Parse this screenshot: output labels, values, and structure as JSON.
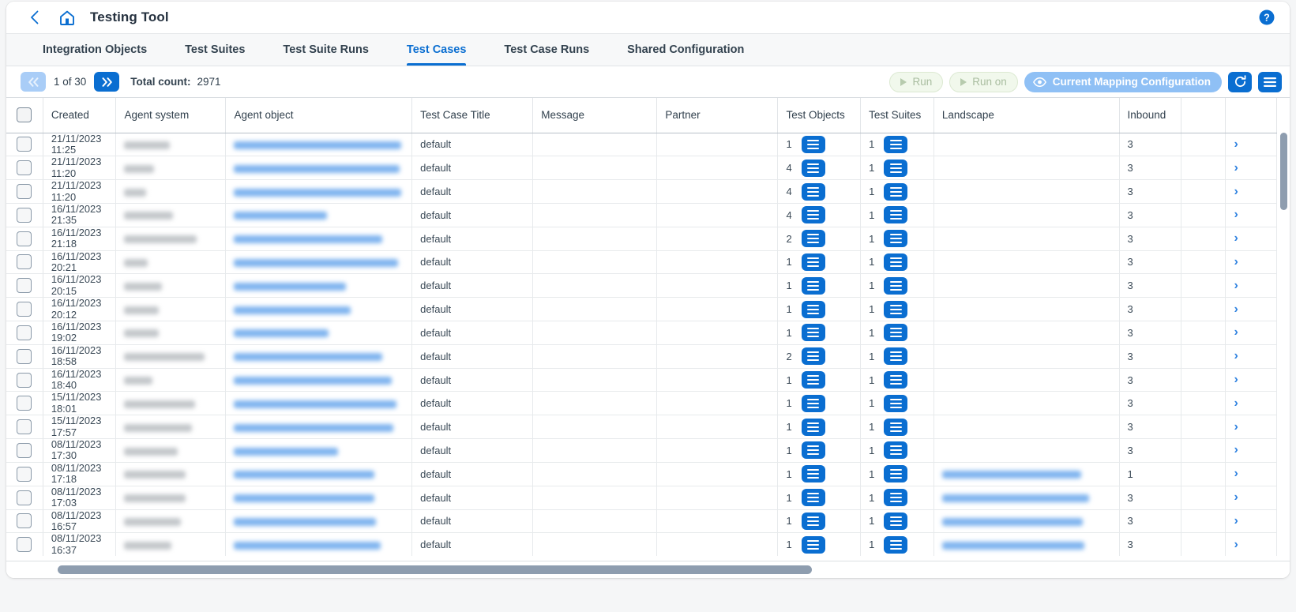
{
  "header": {
    "title": "Testing Tool",
    "back_icon": "chevron-left-icon",
    "home_icon": "home-icon",
    "help_icon": "help-circle-icon",
    "accent": "#0a6ed1"
  },
  "tabs": [
    {
      "label": "Integration Objects",
      "active": false
    },
    {
      "label": "Test Suites",
      "active": false
    },
    {
      "label": "Test Suite Runs",
      "active": false
    },
    {
      "label": "Test Cases",
      "active": true
    },
    {
      "label": "Test Case Runs",
      "active": false
    },
    {
      "label": "Shared Configuration",
      "active": false
    }
  ],
  "toolbar": {
    "prev_icon": "double-chevron-left-icon",
    "next_icon": "double-chevron-right-icon",
    "page_label": "1 of 30",
    "total_label": "Total count:",
    "total_value": "2971",
    "run_label": "Run",
    "run_on_label": "Run on",
    "mapping_label": "Current Mapping Configuration",
    "mapping_icon": "eye-icon",
    "refresh_icon": "refresh-icon",
    "menu_icon": "hamburger-menu-icon"
  },
  "table": {
    "columns": [
      "Created",
      "Agent system",
      "Agent object",
      "Test Case Title",
      "Message",
      "Partner",
      "Test Objects",
      "Test Suites",
      "Landscape",
      "Inbound"
    ],
    "rows": [
      {
        "created_date": "21/11/2023",
        "created_time": "11:25",
        "agent_system": "redacted",
        "agent_object": "redacted",
        "title": "default",
        "message": "",
        "partner": "",
        "test_objects": "1",
        "test_suites": "1",
        "landscape": "",
        "inbound": "3"
      },
      {
        "created_date": "21/11/2023",
        "created_time": "11:20",
        "agent_system": "redacted",
        "agent_object": "redacted",
        "title": "default",
        "message": "",
        "partner": "",
        "test_objects": "4",
        "test_suites": "1",
        "landscape": "",
        "inbound": "3"
      },
      {
        "created_date": "21/11/2023",
        "created_time": "11:20",
        "agent_system": "redacted",
        "agent_object": "redacted",
        "title": "default",
        "message": "",
        "partner": "",
        "test_objects": "4",
        "test_suites": "1",
        "landscape": "",
        "inbound": "3"
      },
      {
        "created_date": "16/11/2023",
        "created_time": "21:35",
        "agent_system": "redacted",
        "agent_object": "redacted",
        "title": "default",
        "message": "",
        "partner": "",
        "test_objects": "4",
        "test_suites": "1",
        "landscape": "",
        "inbound": "3"
      },
      {
        "created_date": "16/11/2023",
        "created_time": "21:18",
        "agent_system": "redacted",
        "agent_object": "redacted",
        "title": "default",
        "message": "",
        "partner": "",
        "test_objects": "2",
        "test_suites": "1",
        "landscape": "",
        "inbound": "3"
      },
      {
        "created_date": "16/11/2023",
        "created_time": "20:21",
        "agent_system": "redacted",
        "agent_object": "redacted",
        "title": "default",
        "message": "",
        "partner": "",
        "test_objects": "1",
        "test_suites": "1",
        "landscape": "",
        "inbound": "3"
      },
      {
        "created_date": "16/11/2023",
        "created_time": "20:15",
        "agent_system": "redacted",
        "agent_object": "redacted",
        "title": "default",
        "message": "",
        "partner": "",
        "test_objects": "1",
        "test_suites": "1",
        "landscape": "",
        "inbound": "3"
      },
      {
        "created_date": "16/11/2023",
        "created_time": "20:12",
        "agent_system": "redacted",
        "agent_object": "redacted",
        "title": "default",
        "message": "",
        "partner": "",
        "test_objects": "1",
        "test_suites": "1",
        "landscape": "",
        "inbound": "3"
      },
      {
        "created_date": "16/11/2023",
        "created_time": "19:02",
        "agent_system": "redacted",
        "agent_object": "redacted",
        "title": "default",
        "message": "",
        "partner": "",
        "test_objects": "1",
        "test_suites": "1",
        "landscape": "",
        "inbound": "3"
      },
      {
        "created_date": "16/11/2023",
        "created_time": "18:58",
        "agent_system": "redacted",
        "agent_object": "redacted",
        "title": "default",
        "message": "",
        "partner": "",
        "test_objects": "2",
        "test_suites": "1",
        "landscape": "",
        "inbound": "3"
      },
      {
        "created_date": "16/11/2023",
        "created_time": "18:40",
        "agent_system": "redacted",
        "agent_object": "redacted",
        "title": "default",
        "message": "",
        "partner": "",
        "test_objects": "1",
        "test_suites": "1",
        "landscape": "",
        "inbound": "3"
      },
      {
        "created_date": "15/11/2023",
        "created_time": "18:01",
        "agent_system": "redacted",
        "agent_object": "redacted",
        "title": "default",
        "message": "",
        "partner": "",
        "test_objects": "1",
        "test_suites": "1",
        "landscape": "",
        "inbound": "3"
      },
      {
        "created_date": "15/11/2023",
        "created_time": "17:57",
        "agent_system": "redacted",
        "agent_object": "redacted",
        "title": "default",
        "message": "",
        "partner": "",
        "test_objects": "1",
        "test_suites": "1",
        "landscape": "",
        "inbound": "3"
      },
      {
        "created_date": "08/11/2023",
        "created_time": "17:30",
        "agent_system": "redacted",
        "agent_object": "redacted",
        "title": "default",
        "message": "",
        "partner": "",
        "test_objects": "1",
        "test_suites": "1",
        "landscape": "",
        "inbound": "3"
      },
      {
        "created_date": "08/11/2023",
        "created_time": "17:18",
        "agent_system": "redacted",
        "agent_object": "redacted",
        "title": "default",
        "message": "",
        "partner": "",
        "test_objects": "1",
        "test_suites": "1",
        "landscape": "redacted",
        "inbound": "1"
      },
      {
        "created_date": "08/11/2023",
        "created_time": "17:03",
        "agent_system": "redacted",
        "agent_object": "redacted",
        "title": "default",
        "message": "",
        "partner": "",
        "test_objects": "1",
        "test_suites": "1",
        "landscape": "redacted",
        "inbound": "3"
      },
      {
        "created_date": "08/11/2023",
        "created_time": "16:57",
        "agent_system": "redacted",
        "agent_object": "redacted",
        "title": "default",
        "message": "",
        "partner": "",
        "test_objects": "1",
        "test_suites": "1",
        "landscape": "redacted",
        "inbound": "3"
      },
      {
        "created_date": "08/11/2023",
        "created_time": "16:37",
        "agent_system": "redacted",
        "agent_object": "redacted",
        "title": "default",
        "message": "",
        "partner": "",
        "test_objects": "1",
        "test_suites": "1",
        "landscape": "redacted",
        "inbound": "3"
      }
    ],
    "row_detail_icon": "chevron-right-icon",
    "list_icon": "list-menu-icon",
    "select_all_icon": "checkbox-unchecked-icon"
  },
  "scrollbars": {
    "vertical": "vertical-scrollbar",
    "horizontal": "horizontal-scrollbar"
  }
}
